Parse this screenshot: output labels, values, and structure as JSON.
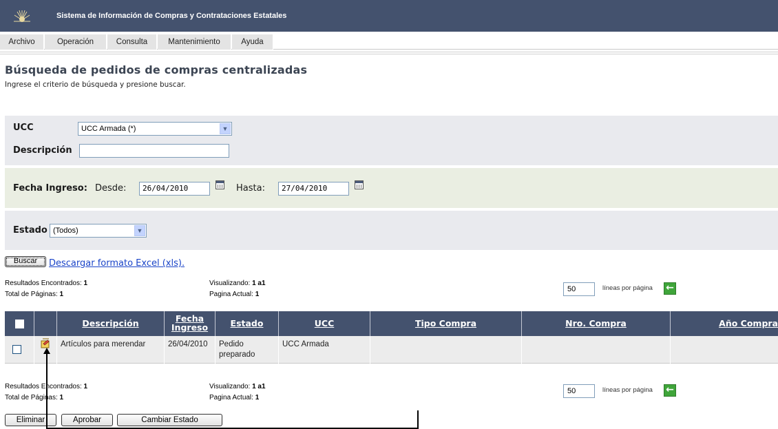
{
  "app": {
    "title": "Sistema de Información de Compras y Contrataciones Estatales"
  },
  "menu": [
    {
      "label": "Archivo"
    },
    {
      "label": "Operación"
    },
    {
      "label": "Consulta"
    },
    {
      "label": "Mantenimiento"
    },
    {
      "label": "Ayuda"
    }
  ],
  "page": {
    "title": "Búsqueda de pedidos de compras centralizadas",
    "subtitle": "Ingrese el criterio de búsqueda y presione buscar."
  },
  "filters": {
    "ucc": {
      "label": "UCC",
      "value": "UCC Armada (*)"
    },
    "descripcion": {
      "label": "Descripción",
      "value": ""
    },
    "fecha": {
      "label": "Fecha Ingreso:",
      "desde_label": "Desde:",
      "desde_value": "26/04/2010",
      "hasta_label": "Hasta:",
      "hasta_value": "27/04/2010"
    },
    "estado": {
      "label": "Estado",
      "value": "(Todos)"
    }
  },
  "actions": {
    "buscar": "Buscar",
    "excel": "Descargar formato Excel (xls)."
  },
  "paging": {
    "resultados_label": "Resultados Encontrados:",
    "resultados_value": "1",
    "total_label": "Total de Páginas:",
    "total_value": "1",
    "visualizando_label": "Visualizando:",
    "visualizando_value": "1 a1",
    "pagina_label": "Pagina Actual:",
    "pagina_value": "1",
    "lineas_value": "50",
    "lineas_label": "líneas por página"
  },
  "table": {
    "headers": [
      "Descripción",
      "Fecha Ingreso",
      "Estado",
      "UCC",
      "Tipo Compra",
      "Nro. Compra",
      "Año Compra"
    ],
    "rows": [
      {
        "descripcion": "Artículos para merendar",
        "fecha": "26/04/2010",
        "estado": "Pedido preparado",
        "ucc": "UCC Armada",
        "tipo": "",
        "nro": "",
        "anio": ""
      }
    ]
  },
  "bottom_buttons": {
    "eliminar": "Eliminar",
    "aprobar": "Aprobar",
    "cambiar": "Cambiar Estado"
  }
}
